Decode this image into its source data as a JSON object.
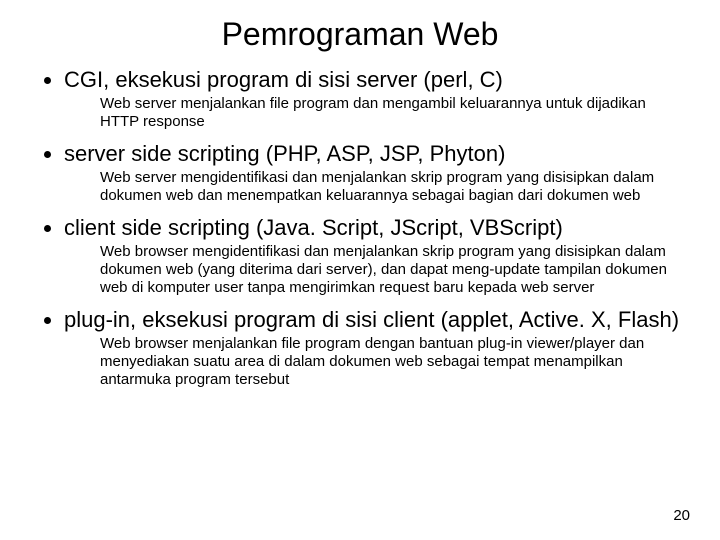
{
  "title": "Pemrograman Web",
  "items": [
    {
      "heading": "CGI, eksekusi program di sisi server (perl, C)",
      "desc": "Web server menjalankan file program dan mengambil keluarannya untuk dijadikan HTTP response"
    },
    {
      "heading": "server side scripting (PHP, ASP, JSP, Phyton)",
      "desc": "Web server mengidentifikasi dan menjalankan skrip program yang disisipkan dalam dokumen web dan menempatkan keluarannya sebagai bagian dari dokumen web"
    },
    {
      "heading": "client side scripting (Java. Script, JScript, VBScript)",
      "desc": "Web browser mengidentifikasi dan menjalankan skrip program yang disisipkan dalam dokumen web (yang diterima dari server), dan dapat meng-update tampilan dokumen web di komputer user tanpa mengirimkan request baru kepada web server"
    },
    {
      "heading": "plug-in, eksekusi program di sisi client (applet, Active. X, Flash)",
      "desc": "Web browser menjalankan file program dengan bantuan plug-in viewer/player dan menyediakan suatu area di dalam dokumen web sebagai tempat menampilkan antarmuka program tersebut"
    }
  ],
  "page_number": "20"
}
